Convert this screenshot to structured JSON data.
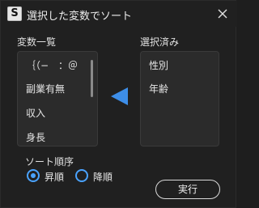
{
  "window": {
    "app_icon_letter": "S",
    "title": "選択した変数でソート"
  },
  "variable_list": {
    "label": "変数一覧",
    "items": [
      "｛（−　：＠",
      "副業有無",
      "収入",
      "身長"
    ]
  },
  "selected_list": {
    "label": "選択済み",
    "items": [
      "性別",
      "年齢"
    ]
  },
  "sort_order": {
    "label": "ソート順序",
    "options": [
      {
        "label": "昇順",
        "checked": true
      },
      {
        "label": "降順",
        "checked": false
      }
    ]
  },
  "actions": {
    "run_label": "実行"
  },
  "colors": {
    "accent": "#4aa3ff",
    "arrow": "#3d8ee8"
  }
}
